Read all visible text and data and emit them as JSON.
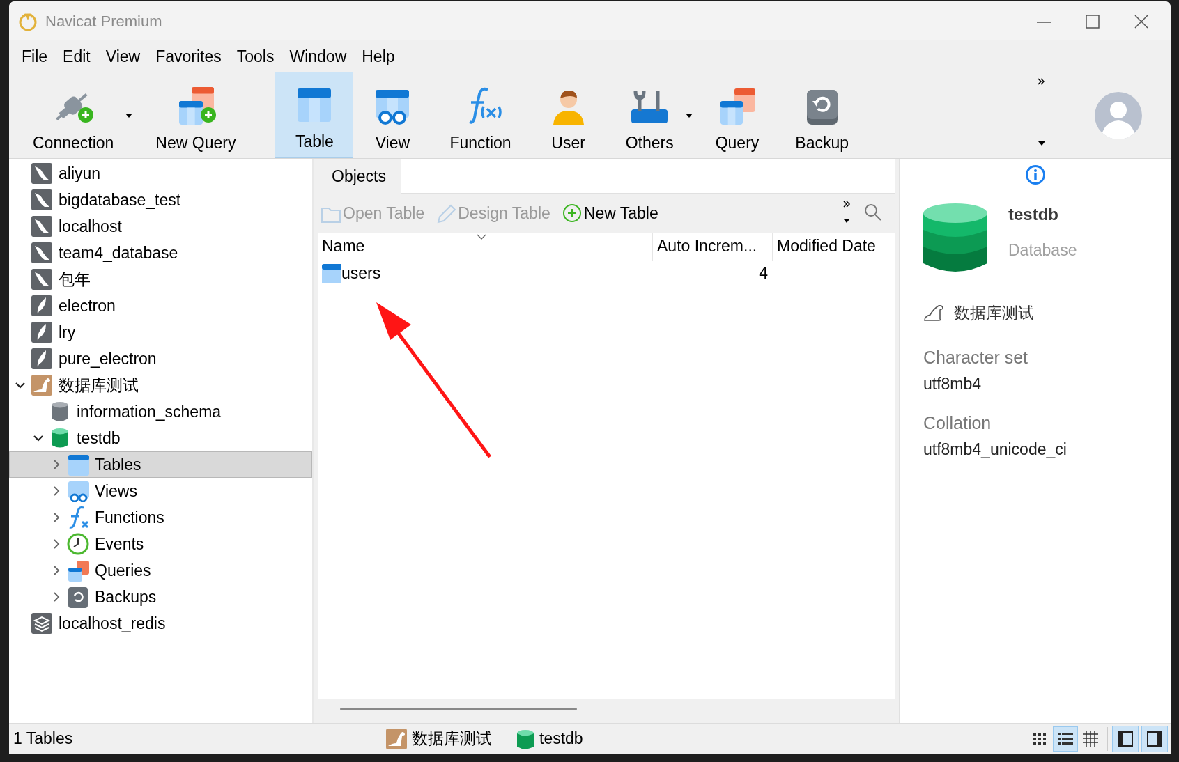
{
  "window": {
    "title": "Navicat Premium"
  },
  "menu": [
    "File",
    "Edit",
    "View",
    "Favorites",
    "Tools",
    "Window",
    "Help"
  ],
  "toolbar": [
    {
      "label": "Connection",
      "kind": "connection",
      "selected": false,
      "dropdown": true
    },
    {
      "label": "New Query",
      "kind": "newquery",
      "selected": false,
      "dropdown": false
    },
    {
      "label": "Table",
      "kind": "table",
      "selected": true,
      "dropdown": false
    },
    {
      "label": "View",
      "kind": "view",
      "selected": false,
      "dropdown": false
    },
    {
      "label": "Function",
      "kind": "function",
      "selected": false,
      "dropdown": false
    },
    {
      "label": "User",
      "kind": "user",
      "selected": false,
      "dropdown": false
    },
    {
      "label": "Others",
      "kind": "others",
      "selected": false,
      "dropdown": true
    },
    {
      "label": "Query",
      "kind": "query",
      "selected": false,
      "dropdown": false
    },
    {
      "label": "Backup",
      "kind": "backup",
      "selected": false,
      "dropdown": false
    }
  ],
  "tree": [
    {
      "label": "aliyun",
      "kind": "mysql",
      "selected": false
    },
    {
      "label": "bigdatabase_test",
      "kind": "mysql",
      "selected": false
    },
    {
      "label": "localhost",
      "kind": "mysql",
      "selected": false
    },
    {
      "label": "team4_database",
      "kind": "mysql",
      "selected": false
    },
    {
      "label": "包年",
      "kind": "mysql",
      "selected": false
    },
    {
      "label": "electron",
      "kind": "sqlite",
      "selected": false
    },
    {
      "label": "lry",
      "kind": "sqlite",
      "selected": false
    },
    {
      "label": "pure_electron",
      "kind": "sqlite",
      "selected": false
    },
    {
      "label": "数据库测试",
      "kind": "mariadb",
      "selected": false,
      "expanded": true,
      "children": [
        {
          "label": "information_schema",
          "kind": "schema",
          "selected": false
        },
        {
          "label": "testdb",
          "kind": "database",
          "selected": false,
          "expanded": true,
          "children": [
            {
              "label": "Tables",
              "kind": "tables",
              "selected": true,
              "expanded": false
            },
            {
              "label": "Views",
              "kind": "views",
              "selected": false,
              "expanded": false
            },
            {
              "label": "Functions",
              "kind": "functions",
              "selected": false,
              "expanded": false
            },
            {
              "label": "Events",
              "kind": "events",
              "selected": false,
              "expanded": false
            },
            {
              "label": "Queries",
              "kind": "queries",
              "selected": false,
              "expanded": false
            },
            {
              "label": "Backups",
              "kind": "backups",
              "selected": false,
              "expanded": false
            }
          ]
        }
      ]
    },
    {
      "label": "localhost_redis",
      "kind": "redis",
      "selected": false
    }
  ],
  "tabs": [
    {
      "label": "Objects",
      "selected": true
    }
  ],
  "object_toolbar": [
    {
      "label": "Open Table",
      "kind": "open",
      "disabled": true
    },
    {
      "label": "Design Table",
      "kind": "design",
      "disabled": true
    },
    {
      "label": "New Table",
      "kind": "new",
      "disabled": false
    }
  ],
  "table": {
    "columns": [
      "Name",
      "Auto Increm...",
      "Modified Date"
    ],
    "rows": [
      {
        "name": "users",
        "auto_increment": "4"
      }
    ]
  },
  "info": {
    "name": "testdb",
    "type": "Database",
    "connection": "数据库测试",
    "fields": [
      {
        "label": "Character set",
        "value": "utf8mb4"
      },
      {
        "label": "Collation",
        "value": "utf8mb4_unicode_ci"
      }
    ]
  },
  "status_bar": {
    "count": "1 Tables",
    "connection": "数据库测试",
    "database": "testdb",
    "view_modes": [
      {
        "kind": "icons",
        "selected": false
      },
      {
        "kind": "list",
        "selected": true
      },
      {
        "kind": "grid",
        "selected": false
      }
    ],
    "panels": [
      {
        "kind": "left",
        "on": true
      },
      {
        "kind": "right",
        "on": true
      }
    ]
  }
}
